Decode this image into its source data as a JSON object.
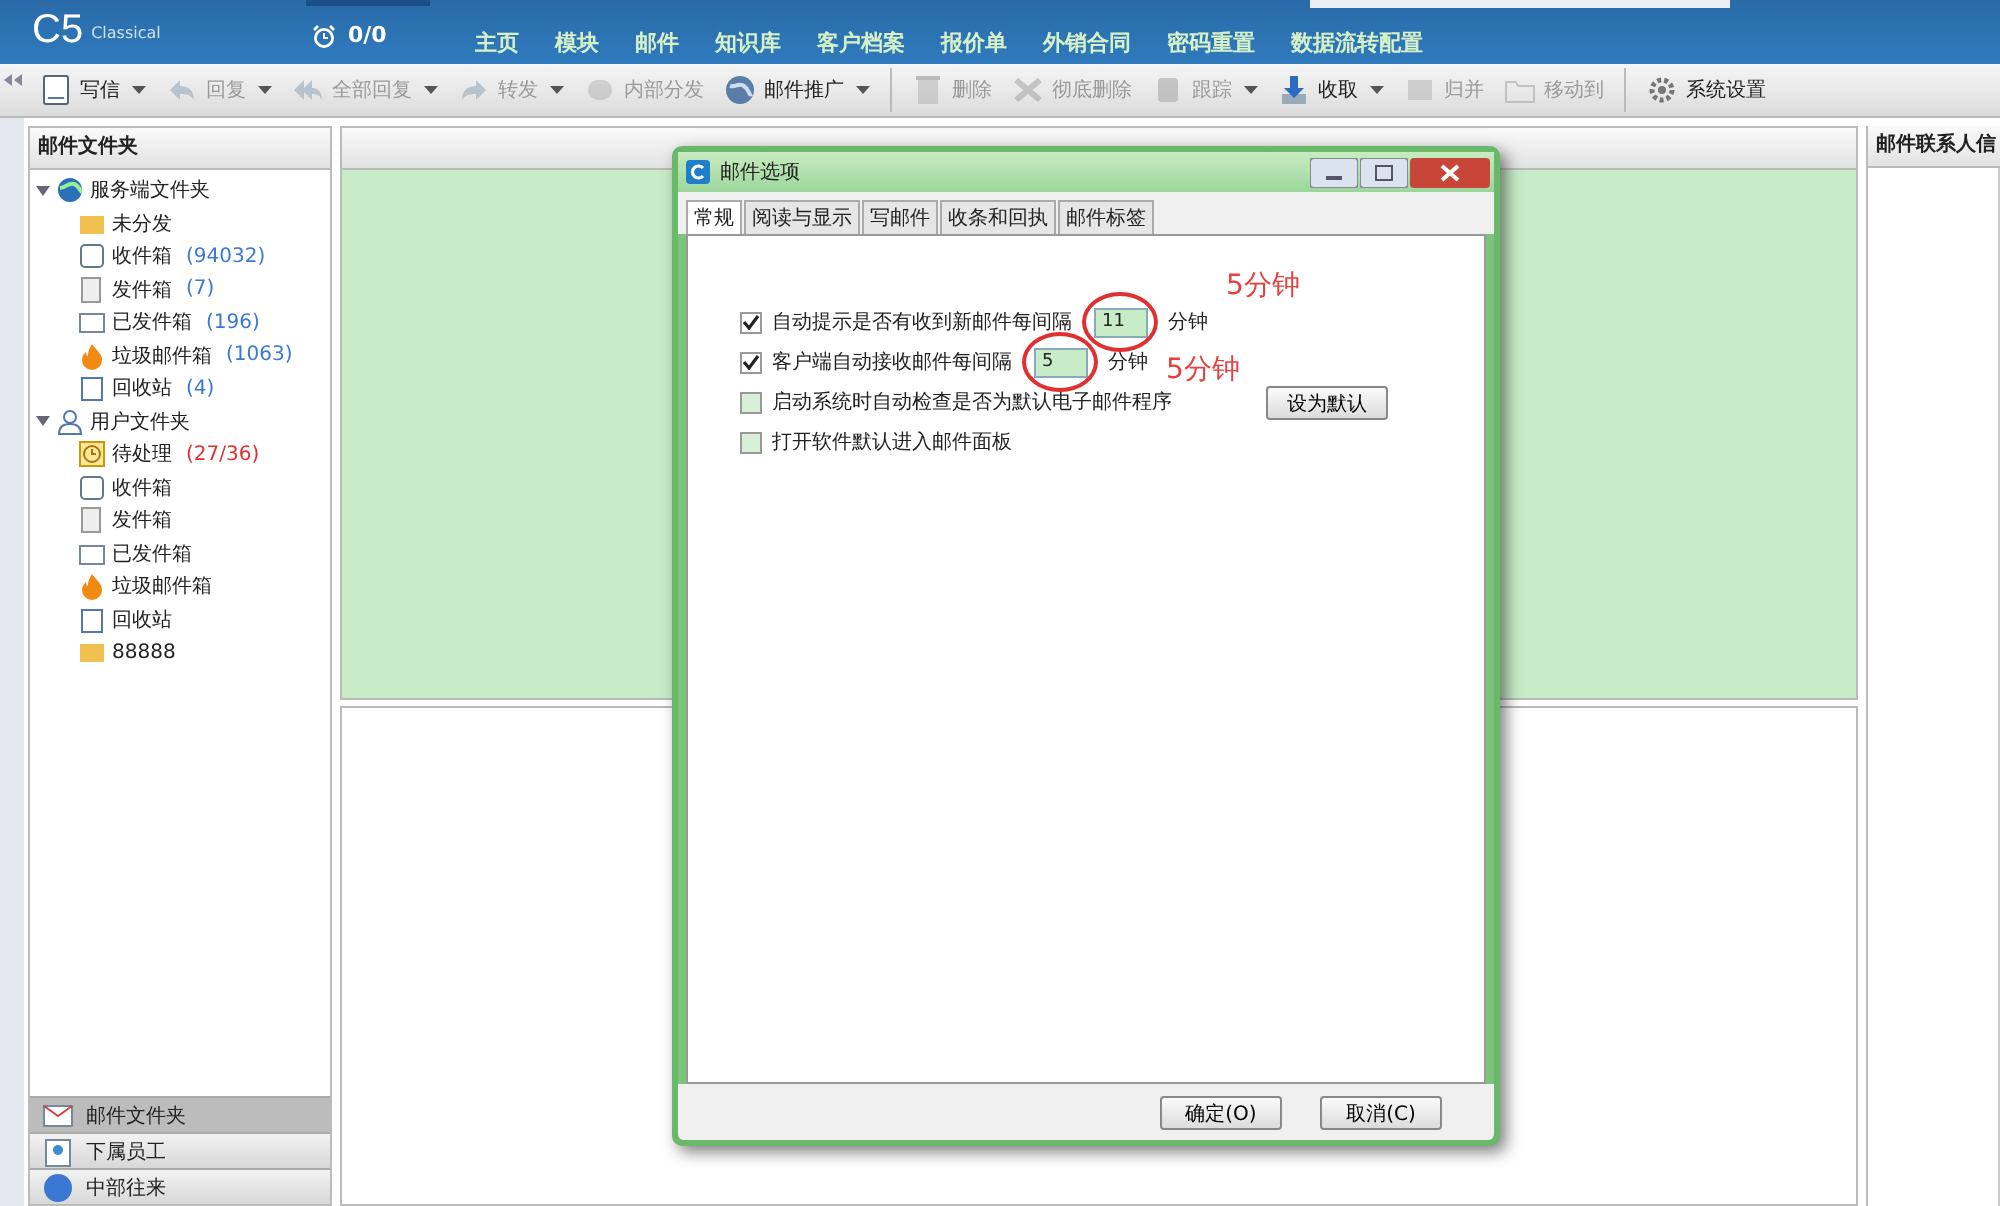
{
  "header": {
    "logo": "C5",
    "logo_sub": "Classical",
    "alarm_count": "0/0",
    "nav": [
      "主页",
      "模块",
      "邮件",
      "知识库",
      "客户档案",
      "报价单",
      "外销合同",
      "密码重置",
      "数据流转配置"
    ]
  },
  "toolbar": [
    {
      "label": "写信",
      "disabled": false,
      "dropdown": true
    },
    {
      "label": "回复",
      "disabled": true,
      "dropdown": true
    },
    {
      "label": "全部回复",
      "disabled": true,
      "dropdown": true
    },
    {
      "label": "转发",
      "disabled": true,
      "dropdown": true
    },
    {
      "label": "内部分发",
      "disabled": true,
      "dropdown": false
    },
    {
      "label": "邮件推广",
      "disabled": false,
      "dropdown": true,
      "separator_after": true
    },
    {
      "label": "删除",
      "disabled": true,
      "dropdown": false
    },
    {
      "label": "彻底删除",
      "disabled": true,
      "dropdown": false
    },
    {
      "label": "跟踪",
      "disabled": true,
      "dropdown": true
    },
    {
      "label": "收取",
      "disabled": false,
      "dropdown": true
    },
    {
      "label": "归并",
      "disabled": true,
      "dropdown": false
    },
    {
      "label": "移动到",
      "disabled": true,
      "dropdown": false,
      "separator_after": true
    },
    {
      "label": "系统设置",
      "disabled": false,
      "dropdown": false
    }
  ],
  "sidebar": {
    "title": "邮件文件夹",
    "tree": [
      {
        "label": "服务端文件夹",
        "expanded": true,
        "children": [
          {
            "label": "未分发"
          },
          {
            "label": "收件箱",
            "count": "(94032)",
            "color": "#3a78d4"
          },
          {
            "label": "发件箱",
            "count": "(7)",
            "color": "#3a78d4"
          },
          {
            "label": "已发件箱",
            "count": "(196)",
            "color": "#3a78d4"
          },
          {
            "label": "垃圾邮件箱",
            "count": "(1063)",
            "color": "#3a78d4"
          },
          {
            "label": "回收站",
            "count": "(4)",
            "color": "#3a78d4"
          }
        ]
      },
      {
        "label": "用户文件夹",
        "expanded": true,
        "children": [
          {
            "label": "待处理",
            "count": "(27/36)",
            "color": "#e03030"
          },
          {
            "label": "收件箱"
          },
          {
            "label": "发件箱"
          },
          {
            "label": "已发件箱"
          },
          {
            "label": "垃圾邮件箱"
          },
          {
            "label": "回收站"
          },
          {
            "label": "88888"
          }
        ]
      }
    ],
    "bottom_nav": [
      {
        "label": "邮件文件夹",
        "selected": true
      },
      {
        "label": "下属员工",
        "selected": false
      },
      {
        "label": "中部往来",
        "selected": false
      }
    ]
  },
  "right_panel": {
    "title": "邮件联系人信"
  },
  "dialog": {
    "title": "邮件选项",
    "tabs": [
      {
        "label": "常规",
        "selected": true
      },
      {
        "label": "阅读与显示",
        "selected": false
      },
      {
        "label": "写邮件",
        "selected": false
      },
      {
        "label": "收条和回执",
        "selected": false
      },
      {
        "label": "邮件标签",
        "selected": false
      }
    ],
    "options": [
      {
        "label": "自动提示是否有收到新邮件每间隔",
        "checked": true,
        "value": "11",
        "unit": "分钟"
      },
      {
        "label": "客户端自动接收邮件每间隔",
        "checked": true,
        "value": "5",
        "unit": "分钟"
      },
      {
        "label": "启动系统时自动检查是否为默认电子邮件程序",
        "checked": false,
        "button": "设为默认"
      },
      {
        "label": "打开软件默认进入邮件面板",
        "checked": false
      }
    ],
    "buttons": [
      "确定(O)",
      "取消(C)"
    ]
  },
  "annotations": [
    {
      "text": "5分钟"
    },
    {
      "text": "5分钟"
    }
  ]
}
